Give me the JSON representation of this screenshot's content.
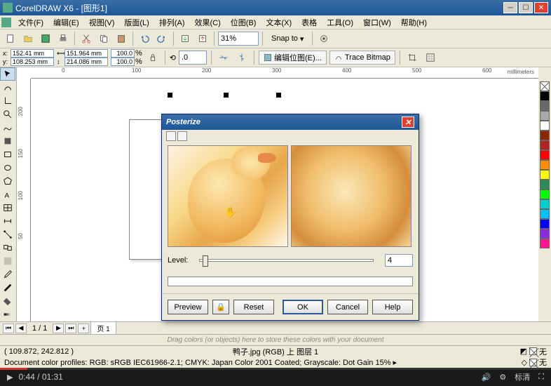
{
  "title": "CorelDRAW X6 - [图形1]",
  "menu": [
    "文件(F)",
    "编辑(E)",
    "视图(V)",
    "版面(L)",
    "排列(A)",
    "效果(C)",
    "位图(B)",
    "文本(X)",
    "表格",
    "工具(O)",
    "窗口(W)",
    "帮助(H)"
  ],
  "toolbar": {
    "zoom": "31%",
    "snap": "Snap to"
  },
  "prop": {
    "x": "152.41 mm",
    "y": "108.253 mm",
    "w": "151.964 mm",
    "h": "214.086 mm",
    "sx": "100.0",
    "sy": "100.0",
    "rot": ".0",
    "editBmp": "编辑位图(E)...",
    "trace": "Trace Bitmap"
  },
  "ruler_h": [
    "0",
    "100",
    "200",
    "300",
    "400",
    "500",
    "600"
  ],
  "ruler_unit": "millimeters",
  "ruler_v": [
    "200",
    "150",
    "100",
    "50"
  ],
  "pager": {
    "pages": "1 / 1",
    "tab": "页 1"
  },
  "docstore": "Drag colors (or objects) here to store these colors with your document",
  "status1": {
    "coord": "( 109.872, 242.812 )",
    "file": "鸭子.jpg (RGB) 上 图层 1"
  },
  "status2": "Document color profiles: RGB: sRGB IEC61966-2.1; CMYK: Japan Color 2001 Coated; Grayscale: Dot Gain 15% ▸",
  "status_none": "无",
  "swatches": [
    "#000",
    "#666",
    "#fff",
    "#8b0000",
    "#b8860b",
    "#808000",
    "#006400",
    "#008080",
    "#00008b",
    "#4b0082",
    "#ff0000",
    "#ff8c00",
    "#ffff00",
    "#00ff00",
    "#00ffff",
    "#0000ff",
    "#ff00ff"
  ],
  "dialog": {
    "title": "Posterize",
    "level_label": "Level:",
    "level_value": "4",
    "preview": "Preview",
    "reset": "Reset",
    "ok": "OK",
    "cancel": "Cancel",
    "help": "Help"
  },
  "player": {
    "time": "0:44 / 01:31",
    "quality": "标清"
  }
}
